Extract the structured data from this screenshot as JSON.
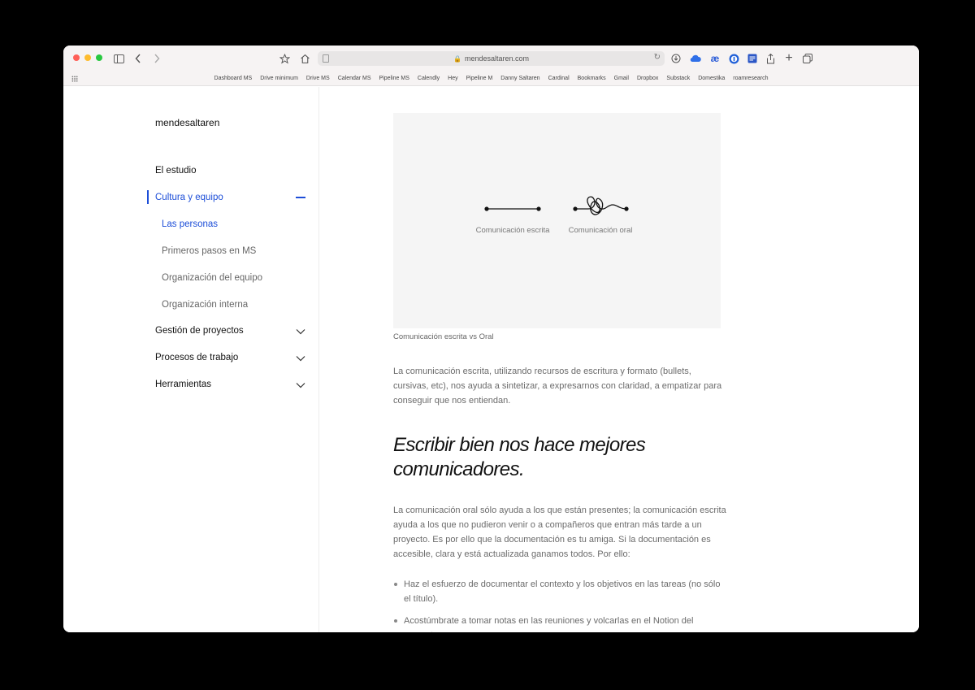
{
  "browser": {
    "url": "mendesaltaren.com",
    "colors": {
      "close": "#ff5f57",
      "minimize": "#febc2e",
      "zoom": "#28c840"
    },
    "bookmarks": [
      "Dashboard MS",
      "Drive minimum",
      "Drive MS",
      "Calendar MS",
      "Pipeline MS",
      "Calendly",
      "Hey",
      "Pipeline M",
      "Danny Saltaren",
      "Cardinal",
      "Bookmarks",
      "Gmail",
      "Dropbox",
      "Substack",
      "Domestika",
      "roamresearch"
    ],
    "extension_text": "æ"
  },
  "sidebar": {
    "brand": "mendesaltaren",
    "accent": "#1d4ed8",
    "items": [
      {
        "label": "El estudio"
      },
      {
        "label": "Cultura y equipo",
        "active": true
      },
      {
        "label": "Las personas",
        "active": true
      },
      {
        "label": "Primeros pasos en MS"
      },
      {
        "label": "Organización del equipo"
      },
      {
        "label": "Organización interna"
      },
      {
        "label": "Gestión de proyectos"
      },
      {
        "label": "Procesos de trabajo"
      },
      {
        "label": "Herramientas"
      }
    ]
  },
  "content": {
    "figure": {
      "left_label": "Comunicación escrita",
      "right_label": "Comunicación oral"
    },
    "caption": "Comunicación escrita vs Oral",
    "para1": "La comunicación escrita, utilizando recursos de escritura y formato (bullets, cursivas, etc), nos ayuda a sintetizar, a expresarnos con claridad, a empatizar para conseguir que nos entiendan.",
    "heading": "Escribir bien nos hace mejores comunicadores.",
    "para2": "La comunicación oral sólo ayuda a los que están presentes; la comunicación escrita ayuda a los que no pudieron venir o a compañeros que entran más tarde a un proyecto. Es por ello que la documentación es tu amiga. Si la documentación es accesible, clara y está actualizada ganamos todos. Por ello:",
    "bullets": [
      "Haz el esfuerzo de documentar el contexto y los objetivos en las tareas (no sólo el título).",
      "Acostúmbrate a tomar notas en las reuniones y volcarlas en el Notion del proyecto."
    ]
  }
}
